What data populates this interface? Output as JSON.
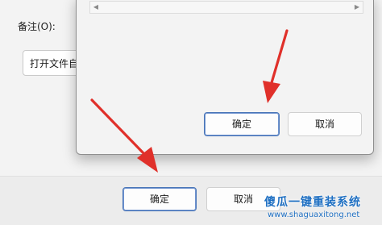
{
  "background_dialog": {
    "remark_label": "备注(O):",
    "input_value": "打开文件自",
    "ok_label": "确定",
    "cancel_label": "取消"
  },
  "foreground_dialog": {
    "ok_label": "确定",
    "cancel_label": "取消",
    "scroll_left_icon": "triangle-left",
    "scroll_right_icon": "triangle-right"
  },
  "annotation": {
    "arrow_color": "#e0302a"
  },
  "watermark": {
    "title": "傻瓜一键重装系统",
    "url": "www.shaguaxitong.net"
  }
}
